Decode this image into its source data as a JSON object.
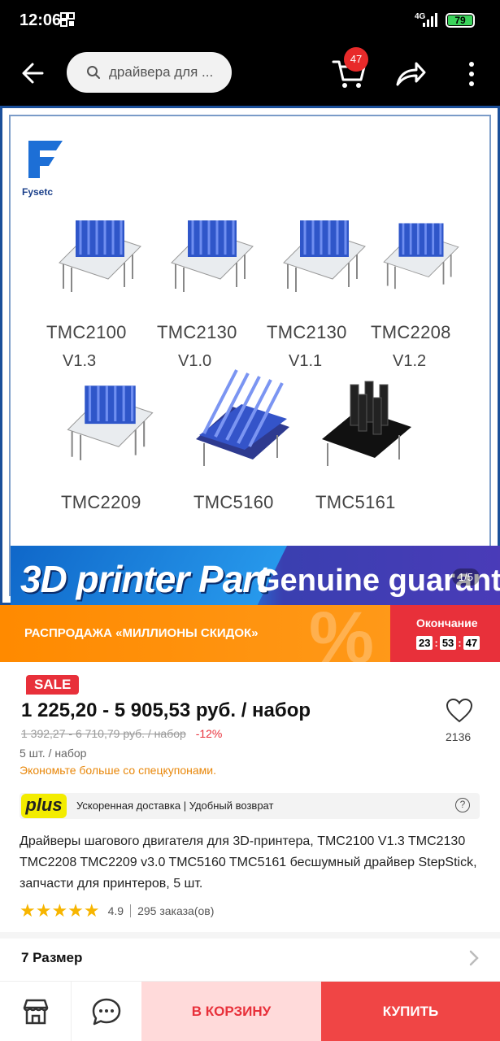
{
  "status_bar": {
    "time": "12:06",
    "network": "4G",
    "battery": "79"
  },
  "app_bar": {
    "search_placeholder": "драйвера для ...",
    "cart_count": "47"
  },
  "gallery": {
    "brand": "Fysetc",
    "chips": [
      {
        "name": "TMC2100",
        "version": "V1.3"
      },
      {
        "name": "TMC2130",
        "version": "V1.0"
      },
      {
        "name": "TMC2130",
        "version": "V1.1"
      },
      {
        "name": "TMC2208",
        "version": "V1.2"
      },
      {
        "name": "TMC2209",
        "version": ""
      },
      {
        "name": "TMC5160",
        "version": ""
      },
      {
        "name": "TMC5161",
        "version": ""
      }
    ],
    "banner_left": "3D printer Part",
    "banner_right": "Genuine guarantee",
    "pager": "1/5"
  },
  "sale_bar": {
    "text": "РАСПРОДАЖА «МИЛЛИОНЫ СКИДОК»",
    "end_label": "Окончание",
    "hours": "23",
    "minutes": "53",
    "seconds": "47"
  },
  "product": {
    "sale_badge": "SALE",
    "price": "1 225,20 - 5 905,53 руб. / набор",
    "old_price": "1 392,27 - 6 710,79 руб. / набор",
    "discount": "-12%",
    "unit": "5 шт. / набор",
    "coupon_text": "Экономьте больше со спецкупонами.",
    "favorites": "2136",
    "plus_label": "plus",
    "plus_text": "Ускоренная доставка | Удобный возврат",
    "help_icon": "?",
    "title": "Драйверы шагового двигателя для 3D-принтера, TMC2100 V1.3 TMC2130 TMC2208 TMC2209 v3.0 TMC5160 TMC5161 бесшумный драйвер StepStick, запчасти для принтеров, 5 шт.",
    "stars": "★★★★★",
    "rating": "4.9",
    "orders": "295 заказа(ов)",
    "size_label": "7 Размер"
  },
  "bottom_bar": {
    "add_to_cart": "В КОРЗИНУ",
    "buy": "КУПИТЬ"
  },
  "colors": {
    "accent": "#e8303a",
    "sale_orange": "#ff8a00",
    "plus_yellow": "#f3ec00",
    "star": "#f7b500"
  }
}
